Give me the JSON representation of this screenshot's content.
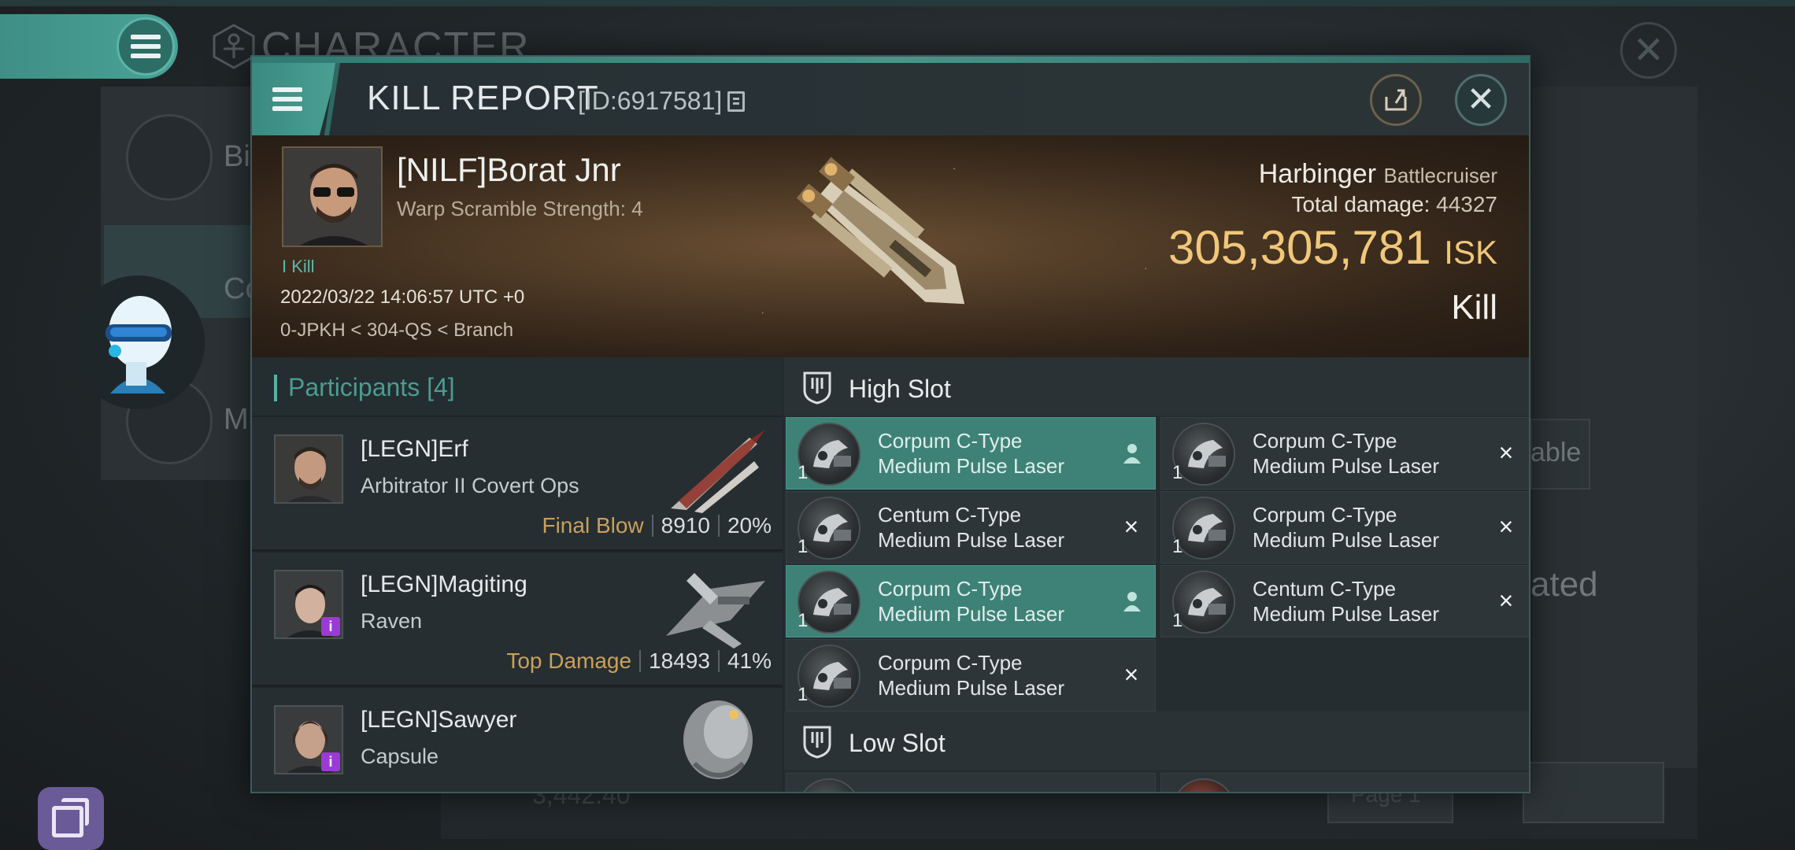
{
  "background": {
    "screen_title": "CHARACTER",
    "side_labels": [
      "Bi",
      "Co",
      "M"
    ],
    "right_labels": [
      "able",
      "ated"
    ],
    "bottom_value": "3,442.40",
    "bottom_page": "Page 1"
  },
  "modal": {
    "title": "KILL REPORT",
    "id_text": "[ID:6917581]"
  },
  "victim": {
    "name": "[NILF]Borat Jnr",
    "subtitle": "Warp Scramble Strength: 4",
    "kill_tag": "I Kill",
    "datetime": "2022/03/22 14:06:57 UTC +0",
    "location": "0-JPKH < 304-QS < Branch",
    "ship_name": "Harbinger",
    "ship_class": "Battlecruiser",
    "total_damage_label": "Total damage:",
    "total_damage_value": "44327",
    "isk_value": "305,305,781",
    "isk_unit": "ISK",
    "result": "Kill"
  },
  "participants": {
    "header_label": "Participants",
    "header_count": "[4]",
    "rows": [
      {
        "name": "[LEGN]Erf",
        "ship": "Arbitrator II Covert Ops",
        "tag": "Final Blow",
        "damage": "8910",
        "percent": "20%"
      },
      {
        "name": "[LEGN]Magiting",
        "ship": "Raven",
        "tag": "Top Damage",
        "damage": "18493",
        "percent": "41%"
      },
      {
        "name": "[LEGN]Sawyer",
        "ship": "Capsule"
      }
    ]
  },
  "slots": {
    "high_slot_label": "High Slot",
    "low_slot_label": "Low Slot",
    "high_modules": [
      {
        "qty": "1",
        "line1": "Corpum C-Type",
        "line2": "Medium Pulse Laser",
        "selected": true,
        "status": "person"
      },
      {
        "qty": "1",
        "line1": "Corpum C-Type",
        "line2": "Medium Pulse Laser",
        "selected": false,
        "status": "x"
      },
      {
        "qty": "1",
        "line1": "Centum C-Type",
        "line2": "Medium Pulse Laser",
        "selected": false,
        "status": "x"
      },
      {
        "qty": "1",
        "line1": "Corpum C-Type",
        "line2": "Medium Pulse Laser",
        "selected": false,
        "status": "x"
      },
      {
        "qty": "1",
        "line1": "Corpum C-Type",
        "line2": "Medium Pulse Laser",
        "selected": true,
        "status": "person"
      },
      {
        "qty": "1",
        "line1": "Centum C-Type",
        "line2": "Medium Pulse Laser",
        "selected": false,
        "status": "x"
      },
      {
        "qty": "1",
        "line1": "Corpum C-Type",
        "line2": "Medium Pulse Laser",
        "selected": false,
        "status": "x"
      }
    ]
  },
  "icons": {
    "menu": "hamburger-icon",
    "close": "close-icon",
    "share": "share-icon",
    "copy": "copy-icon",
    "slot": "slot-icon",
    "status_x": "×",
    "person": "person-icon"
  }
}
